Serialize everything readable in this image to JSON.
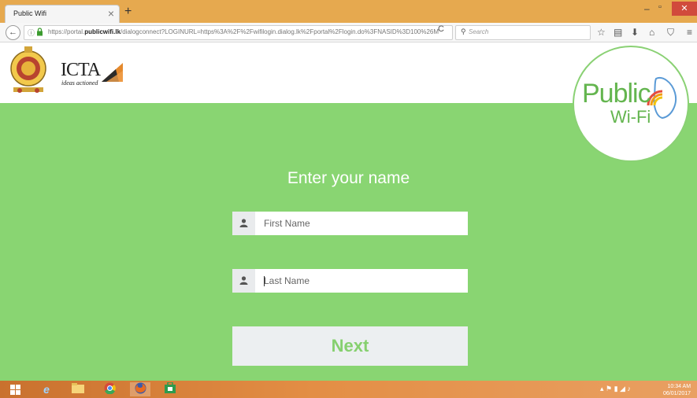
{
  "browser": {
    "tab_title": "Public Wifi",
    "tab_close": "×",
    "new_tab": "+",
    "url_host_prefix": "https://portal.",
    "url_host_bold": "publicwifi.lk",
    "url_rest": "/dialogconnect?LOGINURL=https%3A%2F%2Fwifilogin.dialog.lk%2Fportal%2Flogin.do%3FNASID%3D100%26M",
    "search_placeholder": "Search",
    "window_minimize": "–",
    "window_maximize": "▫",
    "window_close": "✕",
    "back_icon": "←",
    "reload_icon": "C",
    "toolbar_icons": [
      "star-icon",
      "reading-list-icon",
      "download-icon",
      "home-icon",
      "pocket-icon",
      "menu-icon"
    ]
  },
  "header": {
    "icta_logo_text": "ICTA",
    "icta_tagline": "ideas actioned",
    "wifi_logo_line1": "Public",
    "wifi_logo_line2": "Wi-Fi"
  },
  "form": {
    "heading": "Enter your name",
    "first_name_placeholder": "First Name",
    "last_name_placeholder": "Last Name",
    "next_label": "Next"
  },
  "taskbar": {
    "apps": [
      "ie-icon",
      "file-explorer-icon",
      "chrome-icon",
      "firefox-icon",
      "store-icon"
    ],
    "clock_time": "10:34 AM",
    "clock_date": "06/01/2017"
  },
  "colors": {
    "page_green": "#89d572",
    "next_text": "#86d06f",
    "titlebar": "#e6a94f",
    "taskbar": "#e38e45"
  }
}
